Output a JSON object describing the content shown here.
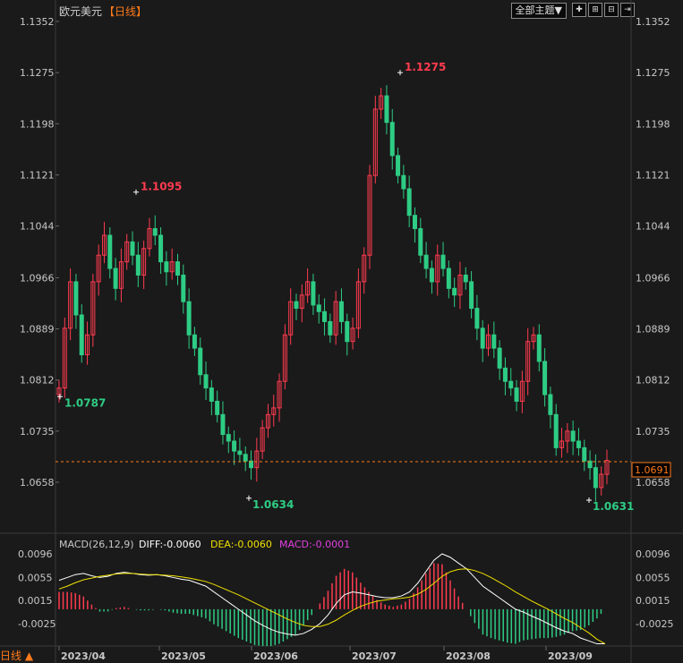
{
  "header": {
    "pair": "欧元美元",
    "timeframe": "【日线】",
    "theme_label": "全部主题▼",
    "tools": [
      "plus-icon",
      "zoom-in-icon",
      "zoom-out-icon",
      "exit-icon"
    ]
  },
  "price_axis": {
    "ticks": [
      "1.1352",
      "1.1275",
      "1.1198",
      "1.1121",
      "1.1044",
      "1.0966",
      "1.0889",
      "1.0812",
      "1.0735",
      "1.0658"
    ],
    "current_price": "1.0691"
  },
  "annotations": {
    "high_main": "1.1275",
    "high_may": "1.1095",
    "low_april": "1.0787",
    "low_june": "1.0634",
    "low_sept": "1.0631"
  },
  "macd": {
    "label": "MACD(26,12,9)",
    "diff_label": "DIFF:-0.0060",
    "dea_label": "DEA:-0.0060",
    "macd_label": "MACD:-0.0001",
    "ticks": [
      "0.0096",
      "0.0055",
      "0.0015",
      "-0.0025"
    ]
  },
  "time_axis": [
    "2023/04",
    "2023/05",
    "2023/06",
    "2023/07",
    "2023/08",
    "2023/09"
  ],
  "bottom_tab": "日线 ▲",
  "colors": {
    "up": "#ff3b4f",
    "down": "#2ecc84",
    "diff": "#ffffff",
    "dea": "#f0e000",
    "current": "#ff7a1a"
  },
  "chart_data": [
    {
      "type": "candlestick",
      "title": "",
      "xlabel": "",
      "ylabel": "",
      "ylim": [
        1.058,
        1.1352
      ],
      "x_range": [
        "2023/04",
        "2023/09"
      ],
      "closes": [
        1.08,
        1.089,
        1.096,
        1.091,
        1.085,
        1.088,
        1.096,
        1.1,
        1.103,
        1.098,
        1.095,
        1.099,
        1.102,
        1.1,
        1.097,
        1.101,
        1.104,
        1.103,
        1.099,
        1.0975,
        1.099,
        1.097,
        1.093,
        1.088,
        1.086,
        1.082,
        1.08,
        1.078,
        1.076,
        1.073,
        1.072,
        1.0705,
        1.07,
        1.069,
        1.068,
        1.0705,
        1.074,
        1.076,
        1.077,
        1.081,
        1.088,
        1.093,
        1.092,
        1.094,
        1.096,
        1.0925,
        1.0915,
        1.09,
        1.088,
        1.093,
        1.09,
        1.087,
        1.089,
        1.096,
        1.1,
        1.112,
        1.122,
        1.124,
        1.12,
        1.115,
        1.112,
        1.11,
        1.106,
        1.104,
        1.1,
        1.098,
        1.096,
        1.1,
        1.098,
        1.095,
        1.094,
        1.097,
        1.096,
        1.092,
        1.089,
        1.086,
        1.088,
        1.086,
        1.083,
        1.081,
        1.08,
        1.078,
        1.081,
        1.087,
        1.088,
        1.084,
        1.079,
        1.076,
        1.071,
        1.072,
        1.0735,
        1.072,
        1.071,
        1.069,
        1.068,
        1.065,
        1.067,
        1.0691
      ],
      "points": [
        {
          "label": "high",
          "date": "2023/07",
          "value": 1.1275
        },
        {
          "label": "high",
          "date": "2023/04",
          "value": 1.1095
        },
        {
          "label": "low",
          "date": "2023/04",
          "value": 1.0787
        },
        {
          "label": "low",
          "date": "2023/05",
          "value": 1.0634
        },
        {
          "label": "low",
          "date": "2023/09",
          "value": 1.0631
        }
      ],
      "current": 1.0691
    },
    {
      "type": "macd",
      "params": "26,12,9",
      "ylim": [
        -0.0045,
        0.011
      ],
      "diff": [
        0.005,
        0.0055,
        0.006,
        0.0062,
        0.0058,
        0.0055,
        0.0057,
        0.0062,
        0.0064,
        0.0062,
        0.006,
        0.0059,
        0.006,
        0.0058,
        0.0055,
        0.0052,
        0.005,
        0.0045,
        0.004,
        0.003,
        0.002,
        0.001,
        0.0,
        -0.001,
        -0.002,
        -0.0028,
        -0.0035,
        -0.004,
        -0.0043,
        -0.0045,
        -0.0042,
        -0.0035,
        -0.0025,
        -0.001,
        0.001,
        0.0025,
        0.003,
        0.0028,
        0.0025,
        0.0022,
        0.002,
        0.002,
        0.0023,
        0.003,
        0.0045,
        0.0065,
        0.0085,
        0.0096,
        0.009,
        0.008,
        0.007,
        0.0055,
        0.004,
        0.003,
        0.002,
        0.001,
        0.0,
        -0.0005,
        -0.0012,
        -0.0018,
        -0.0025,
        -0.0032,
        -0.0038,
        -0.0042,
        -0.005,
        -0.0055,
        -0.006,
        -0.006
      ],
      "dea": [
        0.0035,
        0.004,
        0.0046,
        0.0051,
        0.0054,
        0.0057,
        0.0059,
        0.0061,
        0.0062,
        0.0062,
        0.0061,
        0.006,
        0.006,
        0.0059,
        0.0058,
        0.0056,
        0.0054,
        0.0051,
        0.0048,
        0.0043,
        0.0037,
        0.0031,
        0.0025,
        0.0018,
        0.0011,
        0.0004,
        -0.0003,
        -0.001,
        -0.0017,
        -0.0023,
        -0.0028,
        -0.003,
        -0.003,
        -0.0026,
        -0.0019,
        -0.001,
        -0.0002,
        0.0005,
        0.001,
        0.0014,
        0.0016,
        0.0018,
        0.0019,
        0.0021,
        0.0026,
        0.0034,
        0.0045,
        0.0057,
        0.0065,
        0.0069,
        0.007,
        0.0067,
        0.0062,
        0.0055,
        0.0047,
        0.0039,
        0.003,
        0.0022,
        0.0014,
        0.0007,
        0.0,
        -0.0008,
        -0.0016,
        -0.0023,
        -0.0032,
        -0.0041,
        -0.0052,
        -0.006
      ]
    }
  ]
}
